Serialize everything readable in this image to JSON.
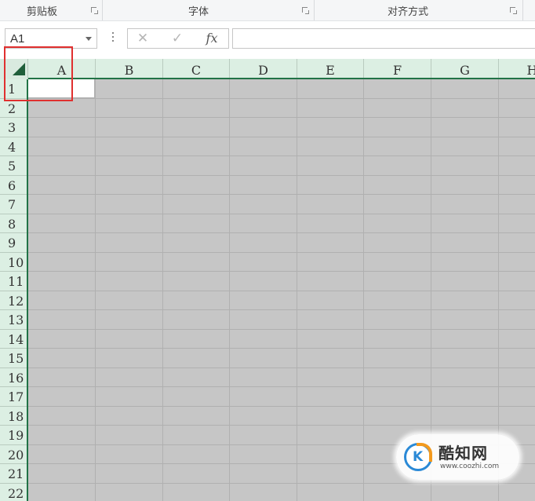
{
  "ribbon": {
    "groups": [
      {
        "label": "剪贴板"
      },
      {
        "label": "字体"
      },
      {
        "label": "对齐方式"
      }
    ]
  },
  "formula_bar": {
    "name_box_value": "A1",
    "cancel_icon": "✕",
    "enter_icon": "✓",
    "fx_label": "fx",
    "formula_value": ""
  },
  "grid": {
    "columns": [
      "A",
      "B",
      "C",
      "D",
      "E",
      "F",
      "G",
      "H"
    ],
    "rows": [
      "1",
      "2",
      "3",
      "4",
      "5",
      "6",
      "7",
      "8",
      "9",
      "10",
      "11",
      "12",
      "13",
      "14",
      "15",
      "16",
      "17",
      "18",
      "19",
      "20",
      "21",
      "22"
    ],
    "active_cell": "A1"
  },
  "watermark": {
    "logo_letter": "K",
    "brand": "酷知网",
    "url": "www.coozhi.com"
  },
  "colors": {
    "header_green": "#dcefe3",
    "selection_border": "#217346",
    "annotation_red": "#e0302f"
  }
}
